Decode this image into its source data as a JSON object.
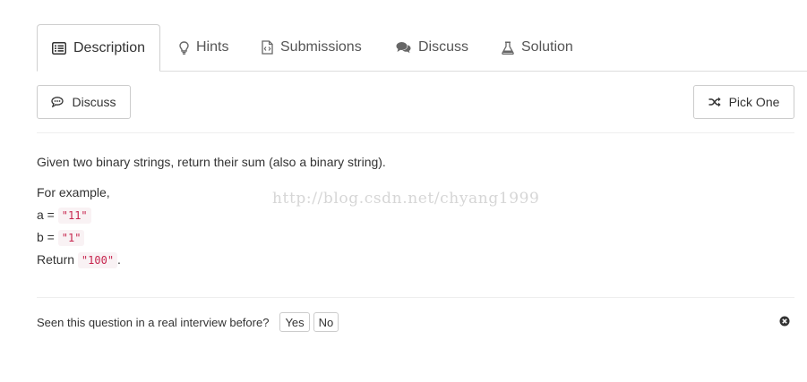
{
  "tabs": [
    {
      "label": "Description",
      "icon": "list-alt-icon",
      "active": true
    },
    {
      "label": "Hints",
      "icon": "lightbulb-icon",
      "active": false
    },
    {
      "label": "Submissions",
      "icon": "file-code-icon",
      "active": false
    },
    {
      "label": "Discuss",
      "icon": "comments-icon",
      "active": false
    },
    {
      "label": "Solution",
      "icon": "flask-icon",
      "active": false
    }
  ],
  "actions": {
    "discuss_label": "Discuss",
    "pick_one_label": "Pick One"
  },
  "problem": {
    "statement": "Given two binary strings, return their sum (also a binary string).",
    "example_intro": "For example,",
    "a_prefix": "a = ",
    "a_value": "\"11\"",
    "b_prefix": "b = ",
    "b_value": "\"1\"",
    "return_prefix": "Return ",
    "return_value": "\"100\"",
    "return_suffix": "."
  },
  "watermark": "http://blog.csdn.net/chyang1999",
  "feedback": {
    "question": "Seen this question in a real interview before?",
    "yes_label": "Yes",
    "no_label": "No"
  },
  "colors": {
    "code_text": "#c7254e",
    "code_bg": "#f9f2f4",
    "border": "#cccccc"
  }
}
